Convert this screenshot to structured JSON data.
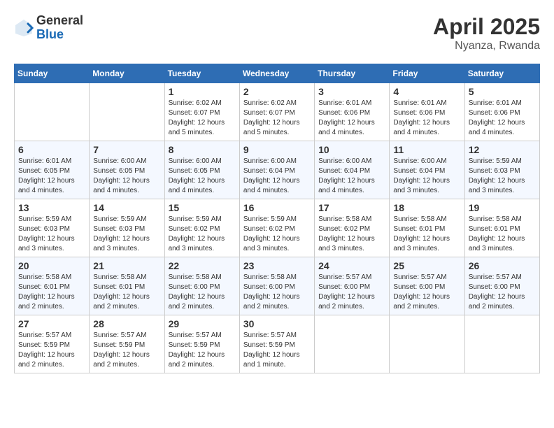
{
  "header": {
    "logo_general": "General",
    "logo_blue": "Blue",
    "title": "April 2025",
    "subtitle": "Nyanza, Rwanda"
  },
  "days_of_week": [
    "Sunday",
    "Monday",
    "Tuesday",
    "Wednesday",
    "Thursday",
    "Friday",
    "Saturday"
  ],
  "weeks": [
    [
      {
        "day": "",
        "info": ""
      },
      {
        "day": "",
        "info": ""
      },
      {
        "day": "1",
        "info": "Sunrise: 6:02 AM\nSunset: 6:07 PM\nDaylight: 12 hours\nand 5 minutes."
      },
      {
        "day": "2",
        "info": "Sunrise: 6:02 AM\nSunset: 6:07 PM\nDaylight: 12 hours\nand 5 minutes."
      },
      {
        "day": "3",
        "info": "Sunrise: 6:01 AM\nSunset: 6:06 PM\nDaylight: 12 hours\nand 4 minutes."
      },
      {
        "day": "4",
        "info": "Sunrise: 6:01 AM\nSunset: 6:06 PM\nDaylight: 12 hours\nand 4 minutes."
      },
      {
        "day": "5",
        "info": "Sunrise: 6:01 AM\nSunset: 6:06 PM\nDaylight: 12 hours\nand 4 minutes."
      }
    ],
    [
      {
        "day": "6",
        "info": "Sunrise: 6:01 AM\nSunset: 6:05 PM\nDaylight: 12 hours\nand 4 minutes."
      },
      {
        "day": "7",
        "info": "Sunrise: 6:00 AM\nSunset: 6:05 PM\nDaylight: 12 hours\nand 4 minutes."
      },
      {
        "day": "8",
        "info": "Sunrise: 6:00 AM\nSunset: 6:05 PM\nDaylight: 12 hours\nand 4 minutes."
      },
      {
        "day": "9",
        "info": "Sunrise: 6:00 AM\nSunset: 6:04 PM\nDaylight: 12 hours\nand 4 minutes."
      },
      {
        "day": "10",
        "info": "Sunrise: 6:00 AM\nSunset: 6:04 PM\nDaylight: 12 hours\nand 4 minutes."
      },
      {
        "day": "11",
        "info": "Sunrise: 6:00 AM\nSunset: 6:04 PM\nDaylight: 12 hours\nand 3 minutes."
      },
      {
        "day": "12",
        "info": "Sunrise: 5:59 AM\nSunset: 6:03 PM\nDaylight: 12 hours\nand 3 minutes."
      }
    ],
    [
      {
        "day": "13",
        "info": "Sunrise: 5:59 AM\nSunset: 6:03 PM\nDaylight: 12 hours\nand 3 minutes."
      },
      {
        "day": "14",
        "info": "Sunrise: 5:59 AM\nSunset: 6:03 PM\nDaylight: 12 hours\nand 3 minutes."
      },
      {
        "day": "15",
        "info": "Sunrise: 5:59 AM\nSunset: 6:02 PM\nDaylight: 12 hours\nand 3 minutes."
      },
      {
        "day": "16",
        "info": "Sunrise: 5:59 AM\nSunset: 6:02 PM\nDaylight: 12 hours\nand 3 minutes."
      },
      {
        "day": "17",
        "info": "Sunrise: 5:58 AM\nSunset: 6:02 PM\nDaylight: 12 hours\nand 3 minutes."
      },
      {
        "day": "18",
        "info": "Sunrise: 5:58 AM\nSunset: 6:01 PM\nDaylight: 12 hours\nand 3 minutes."
      },
      {
        "day": "19",
        "info": "Sunrise: 5:58 AM\nSunset: 6:01 PM\nDaylight: 12 hours\nand 3 minutes."
      }
    ],
    [
      {
        "day": "20",
        "info": "Sunrise: 5:58 AM\nSunset: 6:01 PM\nDaylight: 12 hours\nand 2 minutes."
      },
      {
        "day": "21",
        "info": "Sunrise: 5:58 AM\nSunset: 6:01 PM\nDaylight: 12 hours\nand 2 minutes."
      },
      {
        "day": "22",
        "info": "Sunrise: 5:58 AM\nSunset: 6:00 PM\nDaylight: 12 hours\nand 2 minutes."
      },
      {
        "day": "23",
        "info": "Sunrise: 5:58 AM\nSunset: 6:00 PM\nDaylight: 12 hours\nand 2 minutes."
      },
      {
        "day": "24",
        "info": "Sunrise: 5:57 AM\nSunset: 6:00 PM\nDaylight: 12 hours\nand 2 minutes."
      },
      {
        "day": "25",
        "info": "Sunrise: 5:57 AM\nSunset: 6:00 PM\nDaylight: 12 hours\nand 2 minutes."
      },
      {
        "day": "26",
        "info": "Sunrise: 5:57 AM\nSunset: 6:00 PM\nDaylight: 12 hours\nand 2 minutes."
      }
    ],
    [
      {
        "day": "27",
        "info": "Sunrise: 5:57 AM\nSunset: 5:59 PM\nDaylight: 12 hours\nand 2 minutes."
      },
      {
        "day": "28",
        "info": "Sunrise: 5:57 AM\nSunset: 5:59 PM\nDaylight: 12 hours\nand 2 minutes."
      },
      {
        "day": "29",
        "info": "Sunrise: 5:57 AM\nSunset: 5:59 PM\nDaylight: 12 hours\nand 2 minutes."
      },
      {
        "day": "30",
        "info": "Sunrise: 5:57 AM\nSunset: 5:59 PM\nDaylight: 12 hours\nand 1 minute."
      },
      {
        "day": "",
        "info": ""
      },
      {
        "day": "",
        "info": ""
      },
      {
        "day": "",
        "info": ""
      }
    ]
  ]
}
